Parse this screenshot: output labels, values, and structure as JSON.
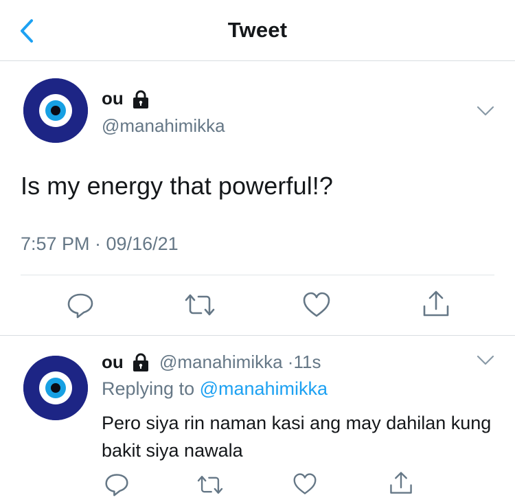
{
  "header": {
    "title": "Tweet"
  },
  "colors": {
    "accent": "#1da1f2",
    "secondary_text": "#657786",
    "avatar_bg": "#1d2585"
  },
  "main_tweet": {
    "display_name": "ou",
    "handle": "@manahimikka",
    "text": "Is my energy that powerful!?",
    "timestamp": "7:57 PM · 09/16/21",
    "icons": {
      "protected": "lock-icon",
      "menu": "chevron-down-icon",
      "avatar": "evil-eye-avatar"
    },
    "actions": [
      "reply-icon",
      "retweet-icon",
      "like-icon",
      "share-icon"
    ]
  },
  "reply": {
    "display_name": "ou",
    "handle": "@manahimikka",
    "separator": "·",
    "time_ago": "11s",
    "replying_prefix": "Replying to ",
    "replying_to": "@manahimikka",
    "text": "Pero siya rin naman kasi ang may dahilan kung bakit siya nawala",
    "actions": [
      "reply-icon",
      "retweet-icon",
      "like-icon",
      "share-icon"
    ]
  }
}
